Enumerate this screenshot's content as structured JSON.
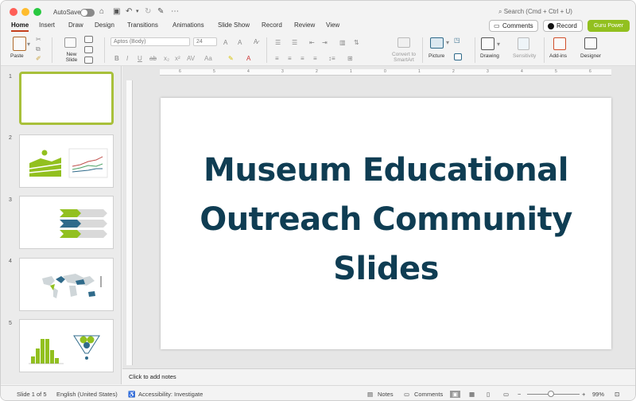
{
  "app": {
    "autosave_label": "AutoSave",
    "search_placeholder": "Search (Cmd + Ctrl + U)"
  },
  "tabs": [
    "Home",
    "Insert",
    "Draw",
    "Design",
    "Transitions",
    "Animations",
    "Slide Show",
    "Record",
    "Review",
    "View"
  ],
  "actions": {
    "comments": "Comments",
    "record": "Record",
    "guru": "Guru Power"
  },
  "ribbon": {
    "paste": "Paste",
    "new_slide": "New Slide",
    "font_name": "Aptos (Body)",
    "font_size": "24",
    "convert_smartart": "Convert to SmartArt",
    "picture": "Picture",
    "drawing": "Drawing",
    "sensitivity": "Sensitivity",
    "addins": "Add-ins",
    "designer": "Designer"
  },
  "thumbnails": [
    {
      "num": "1",
      "kind": "blank"
    },
    {
      "num": "2",
      "kind": "line-chart"
    },
    {
      "num": "3",
      "kind": "arrows"
    },
    {
      "num": "4",
      "kind": "map"
    },
    {
      "num": "5",
      "kind": "histogram"
    }
  ],
  "slide": {
    "title_lines": [
      "Museum Educational",
      "Outreach Community",
      "Slides"
    ]
  },
  "notes_placeholder": "Click to add notes",
  "status": {
    "slide_of": "Slide 1 of 5",
    "language": "English (United States)",
    "accessibility": "Accessibility: Investigate",
    "notes": "Notes",
    "comments": "Comments",
    "zoom": "99%"
  },
  "colors": {
    "accent_green": "#92c01f",
    "title_navy": "#0f3d53",
    "tab_underline": "#c43e1c",
    "thumb_green": "#a8c03a",
    "thumb_blue": "#2f6a8a"
  }
}
